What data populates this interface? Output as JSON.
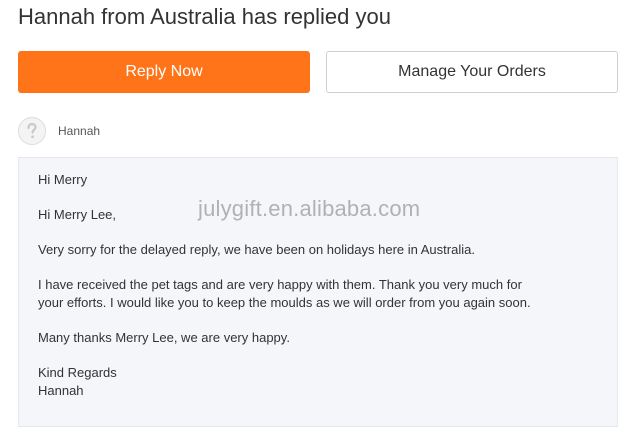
{
  "header": {
    "title": "Hannah from Australia has replied you"
  },
  "actions": {
    "reply_label": "Reply Now",
    "orders_label": "Manage Your Orders"
  },
  "sender": {
    "name": "Hannah",
    "avatar_icon": "user-placeholder-icon"
  },
  "message": {
    "greeting": "Hi Merry",
    "salutation": "Hi Merry Lee,",
    "paragraph1": "Very sorry for the delayed reply, we have been on holidays here in Australia.",
    "paragraph2_line1": "I have received the pet tags and are very happy with them. Thank you very much for",
    "paragraph2_line2": "your efforts. I would like you to keep the moulds as we will order from you again soon.",
    "paragraph3": "Many thanks Merry Lee, we are very happy.",
    "closing": "Kind Regards",
    "signature": "Hannah"
  },
  "watermark": {
    "text": "julygift.en.alibaba.com"
  },
  "colors": {
    "accent": "#ff7418",
    "message_bg": "#f5f6fa"
  }
}
